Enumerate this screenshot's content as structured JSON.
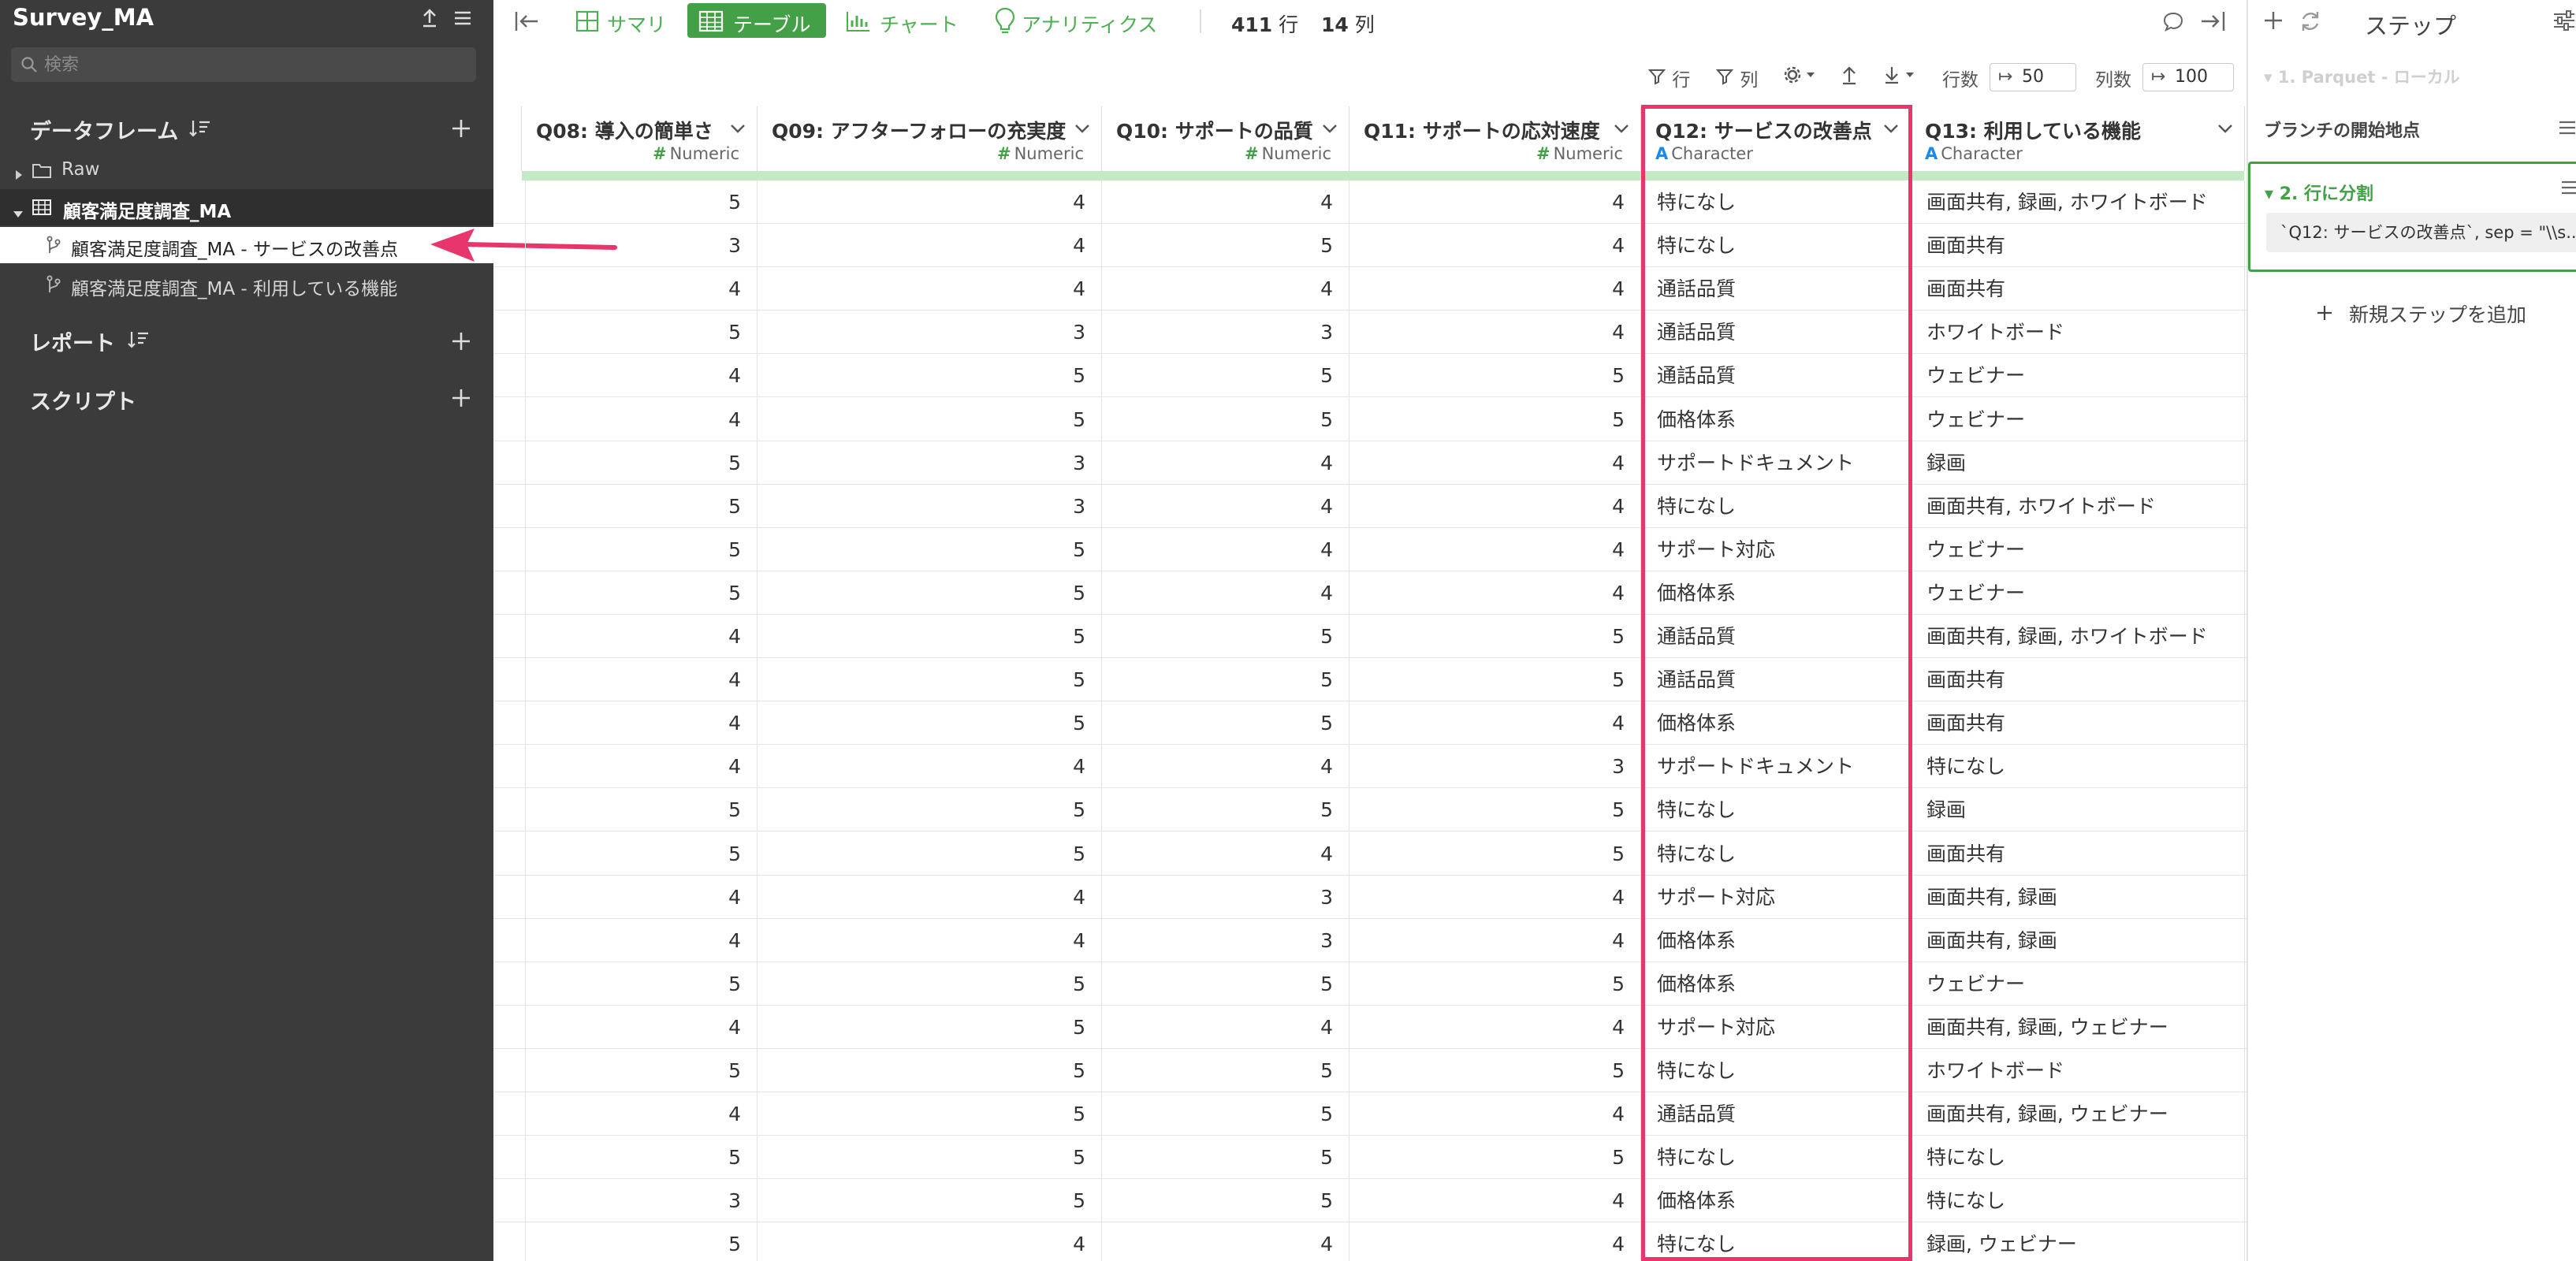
{
  "sidebar": {
    "project_title": "Survey_MA",
    "search_placeholder": "検索",
    "sections": {
      "dataframes": "データフレーム",
      "reports": "レポート",
      "scripts": "スクリプト"
    },
    "tree": {
      "raw_folder": "Raw",
      "dataframe": "顧客満足度調査_MA",
      "branches": [
        "顧客満足度調査_MA - サービスの改善点",
        "顧客満足度調査_MA - 利用している機能"
      ]
    }
  },
  "toolbar": {
    "tabs": [
      "サマリ",
      "テーブル",
      "チャート",
      "アナリティクス"
    ],
    "active_tab": "テーブル",
    "row_count": "411",
    "row_unit": "行",
    "col_count": "14",
    "col_unit": "列"
  },
  "subtoolbar": {
    "row_filter": "行",
    "col_filter": "列",
    "rows_label": "行数",
    "rows_value": "50",
    "cols_label": "列数",
    "cols_value": "100"
  },
  "table": {
    "columns": [
      {
        "name": "Q08: 導入の簡単さ",
        "type": "Numeric"
      },
      {
        "name": "Q09: アフターフォローの充実度",
        "type": "Numeric"
      },
      {
        "name": "Q10: サポートの品質",
        "type": "Numeric"
      },
      {
        "name": "Q11: サポートの応対速度",
        "type": "Numeric"
      },
      {
        "name": "Q12: サービスの改善点",
        "type": "Character"
      },
      {
        "name": "Q13: 利用している機能",
        "type": "Character"
      }
    ],
    "rows": [
      [
        "5",
        "4",
        "4",
        "4",
        "特になし",
        "画面共有, 録画, ホワイトボード"
      ],
      [
        "3",
        "4",
        "5",
        "4",
        "特になし",
        "画面共有"
      ],
      [
        "4",
        "4",
        "4",
        "4",
        "通話品質",
        "画面共有"
      ],
      [
        "5",
        "3",
        "3",
        "4",
        "通話品質",
        "ホワイトボード"
      ],
      [
        "4",
        "5",
        "5",
        "5",
        "通話品質",
        "ウェビナー"
      ],
      [
        "4",
        "5",
        "5",
        "5",
        "価格体系",
        "ウェビナー"
      ],
      [
        "5",
        "3",
        "4",
        "4",
        "サポートドキュメント",
        "録画"
      ],
      [
        "5",
        "3",
        "4",
        "4",
        "特になし",
        "画面共有, ホワイトボード"
      ],
      [
        "5",
        "5",
        "4",
        "4",
        "サポート対応",
        "ウェビナー"
      ],
      [
        "5",
        "5",
        "4",
        "4",
        "価格体系",
        "ウェビナー"
      ],
      [
        "4",
        "5",
        "5",
        "5",
        "通話品質",
        "画面共有, 録画, ホワイトボード"
      ],
      [
        "4",
        "5",
        "5",
        "5",
        "通話品質",
        "画面共有"
      ],
      [
        "4",
        "5",
        "5",
        "4",
        "価格体系",
        "画面共有"
      ],
      [
        "4",
        "4",
        "4",
        "3",
        "サポートドキュメント",
        "特になし"
      ],
      [
        "5",
        "5",
        "5",
        "5",
        "特になし",
        "録画"
      ],
      [
        "5",
        "5",
        "4",
        "5",
        "特になし",
        "画面共有"
      ],
      [
        "4",
        "4",
        "3",
        "4",
        "サポート対応",
        "画面共有, 録画"
      ],
      [
        "4",
        "4",
        "3",
        "4",
        "価格体系",
        "画面共有, 録画"
      ],
      [
        "5",
        "5",
        "5",
        "5",
        "価格体系",
        "ウェビナー"
      ],
      [
        "4",
        "5",
        "4",
        "4",
        "サポート対応",
        "画面共有, 録画, ウェビナー"
      ],
      [
        "5",
        "5",
        "5",
        "5",
        "特になし",
        "ホワイトボード"
      ],
      [
        "4",
        "5",
        "5",
        "4",
        "通話品質",
        "画面共有, 録画, ウェビナー"
      ],
      [
        "5",
        "5",
        "5",
        "5",
        "特になし",
        "特になし"
      ],
      [
        "3",
        "5",
        "5",
        "4",
        "価格体系",
        "特になし"
      ],
      [
        "5",
        "4",
        "4",
        "4",
        "特になし",
        "録画, ウェビナー"
      ]
    ]
  },
  "steps_panel": {
    "title": "ステップ",
    "step1": "1. Parquet - ローカル",
    "branch_label": "ブランチの開始地点",
    "step2_title": "2. 行に分割",
    "step2_detail": "`Q12: サービスの改善点`, sep = \"\\\\s...",
    "add_step": "新規ステップを追加"
  },
  "colors": {
    "sidebar_bg": "#3b3b3b",
    "accent_green": "#43a047",
    "highlight_pink": "#e8356c",
    "numeric_type": "#43a047",
    "character_type": "#1e88e5"
  }
}
